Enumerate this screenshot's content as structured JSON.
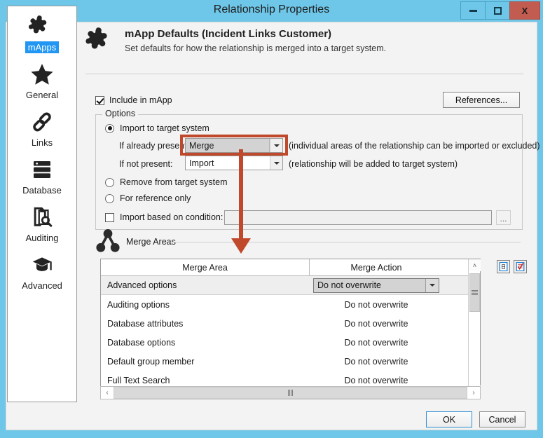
{
  "window": {
    "title": "Relationship Properties",
    "app_icon": "app-orb-icon",
    "minimize_label": "",
    "maximize_label": "",
    "close_label": "X"
  },
  "sidebar": {
    "items": [
      {
        "label": "mApps",
        "icon": "puzzle-piece-icon",
        "selected": true
      },
      {
        "label": "General",
        "icon": "star-icon",
        "selected": false
      },
      {
        "label": "Links",
        "icon": "chain-link-icon",
        "selected": false
      },
      {
        "label": "Database",
        "icon": "database-icon",
        "selected": false
      },
      {
        "label": "Auditing",
        "icon": "document-search-icon",
        "selected": false
      },
      {
        "label": "Advanced",
        "icon": "graduation-cap-icon",
        "selected": false
      }
    ]
  },
  "banner": {
    "icon": "puzzle-piece-icon",
    "title": "mApp Defaults  (Incident Links Customer)",
    "subtitle": "Set defaults for how the relationship is merged into a target system."
  },
  "include": {
    "label": "Include in mApp",
    "checked": true
  },
  "references_button": "References...",
  "options": {
    "legend": "Options",
    "import_to_target": {
      "label": "Import to target system",
      "selected": true
    },
    "if_already_present": {
      "label": "If already present:",
      "value": "Merge",
      "hint": "(individual areas of the relationship can be imported or excluded)"
    },
    "if_not_present": {
      "label": "If not present:",
      "value": "Import",
      "hint": "(relationship will be added to target system)"
    },
    "remove_from_target": {
      "label": "Remove from target system",
      "selected": false
    },
    "for_reference_only": {
      "label": "For reference only",
      "selected": false
    },
    "import_based_on_condition": {
      "label": "Import based on condition:",
      "checked": false,
      "value": "",
      "browse_button": "..."
    }
  },
  "merge_areas": {
    "section_label": "Merge Areas",
    "section_icon": "merge-branch-icon",
    "columns": [
      "Merge Area",
      "Merge Action"
    ],
    "rows": [
      {
        "area": "Advanced options",
        "action": "Do not overwrite",
        "editing": true
      },
      {
        "area": "Auditing options",
        "action": "Do not overwrite",
        "editing": false
      },
      {
        "area": "Database attributes",
        "action": "Do not overwrite",
        "editing": false
      },
      {
        "area": "Database options",
        "action": "Do not overwrite",
        "editing": false
      },
      {
        "area": "Default group member",
        "action": "Do not overwrite",
        "editing": false
      },
      {
        "area": "Full Text Search",
        "action": "Do not overwrite",
        "editing": false
      }
    ],
    "tool_buttons": [
      {
        "icon": "select-none-icon"
      },
      {
        "icon": "select-all-checked-icon"
      }
    ],
    "scroll_up": "˄",
    "scroll_down": "˅",
    "scroll_left": "‹",
    "scroll_right": "›"
  },
  "footer": {
    "ok": "OK",
    "cancel": "Cancel"
  },
  "annotation": {
    "highlight_target": "if-already-present-combo",
    "arrow_points_to": "merge-areas-table"
  },
  "colors": {
    "titlebar": "#6ec6e8",
    "close_button": "#c25b50",
    "selection": "#2196f3",
    "annotation": "#c0492b",
    "client_bg": "#f3f3f3"
  }
}
